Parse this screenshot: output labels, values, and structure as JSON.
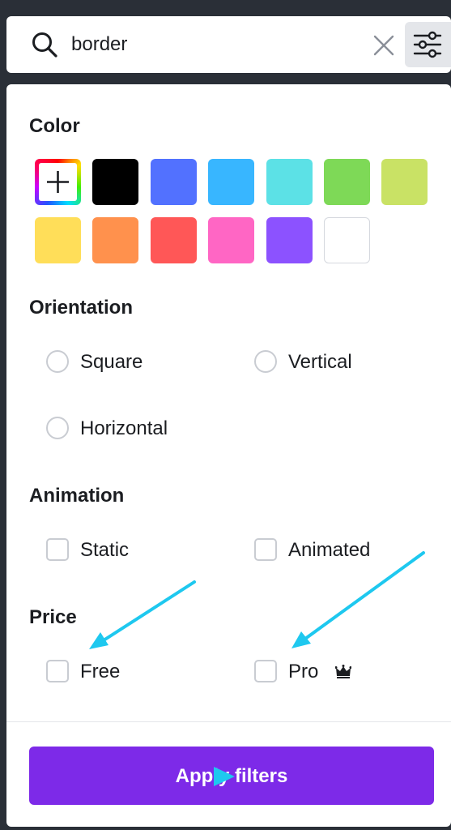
{
  "search": {
    "value": "border",
    "placeholder": ""
  },
  "color_section": {
    "title": "Color",
    "swatches": [
      "custom",
      "#000000",
      "#5271ff",
      "#38b6ff",
      "#5ce1e6",
      "#7ed957",
      "#c9e265",
      "#ffde59",
      "#ff914d",
      "#ff5757",
      "#ff66c4",
      "#8c52ff",
      "#ffffff"
    ]
  },
  "orientation": {
    "title": "Orientation",
    "options": [
      "Square",
      "Vertical",
      "Horizontal"
    ]
  },
  "animation": {
    "title": "Animation",
    "options": [
      "Static",
      "Animated"
    ]
  },
  "price": {
    "title": "Price",
    "options": [
      "Free",
      "Pro"
    ]
  },
  "apply_button": {
    "label": "Apply filters"
  },
  "colors": {
    "accent": "#7d2ae8",
    "annotation_arrow": "#1ec8ef"
  },
  "icons": {
    "search": "search-icon",
    "clear": "close-icon",
    "filter": "sliders-icon",
    "pro_badge": "crown-icon"
  }
}
